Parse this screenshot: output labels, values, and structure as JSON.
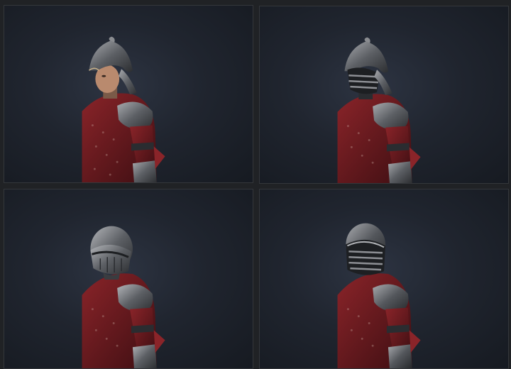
{
  "scene": {
    "background_color": "#1c1e21",
    "panel_background": "#20252f"
  },
  "panels": [
    {
      "helmet": "open-face-morion"
    },
    {
      "helmet": "morion-with-face-bars"
    },
    {
      "helmet": "closed-burgonet"
    },
    {
      "helmet": "closed-burgonet-with-visor-bars"
    }
  ],
  "colors": {
    "armor_red": "#6b1a1f",
    "steel": "#5a5d62",
    "steel_highlight": "#9a9ca0",
    "skin": "#b98a6e"
  }
}
